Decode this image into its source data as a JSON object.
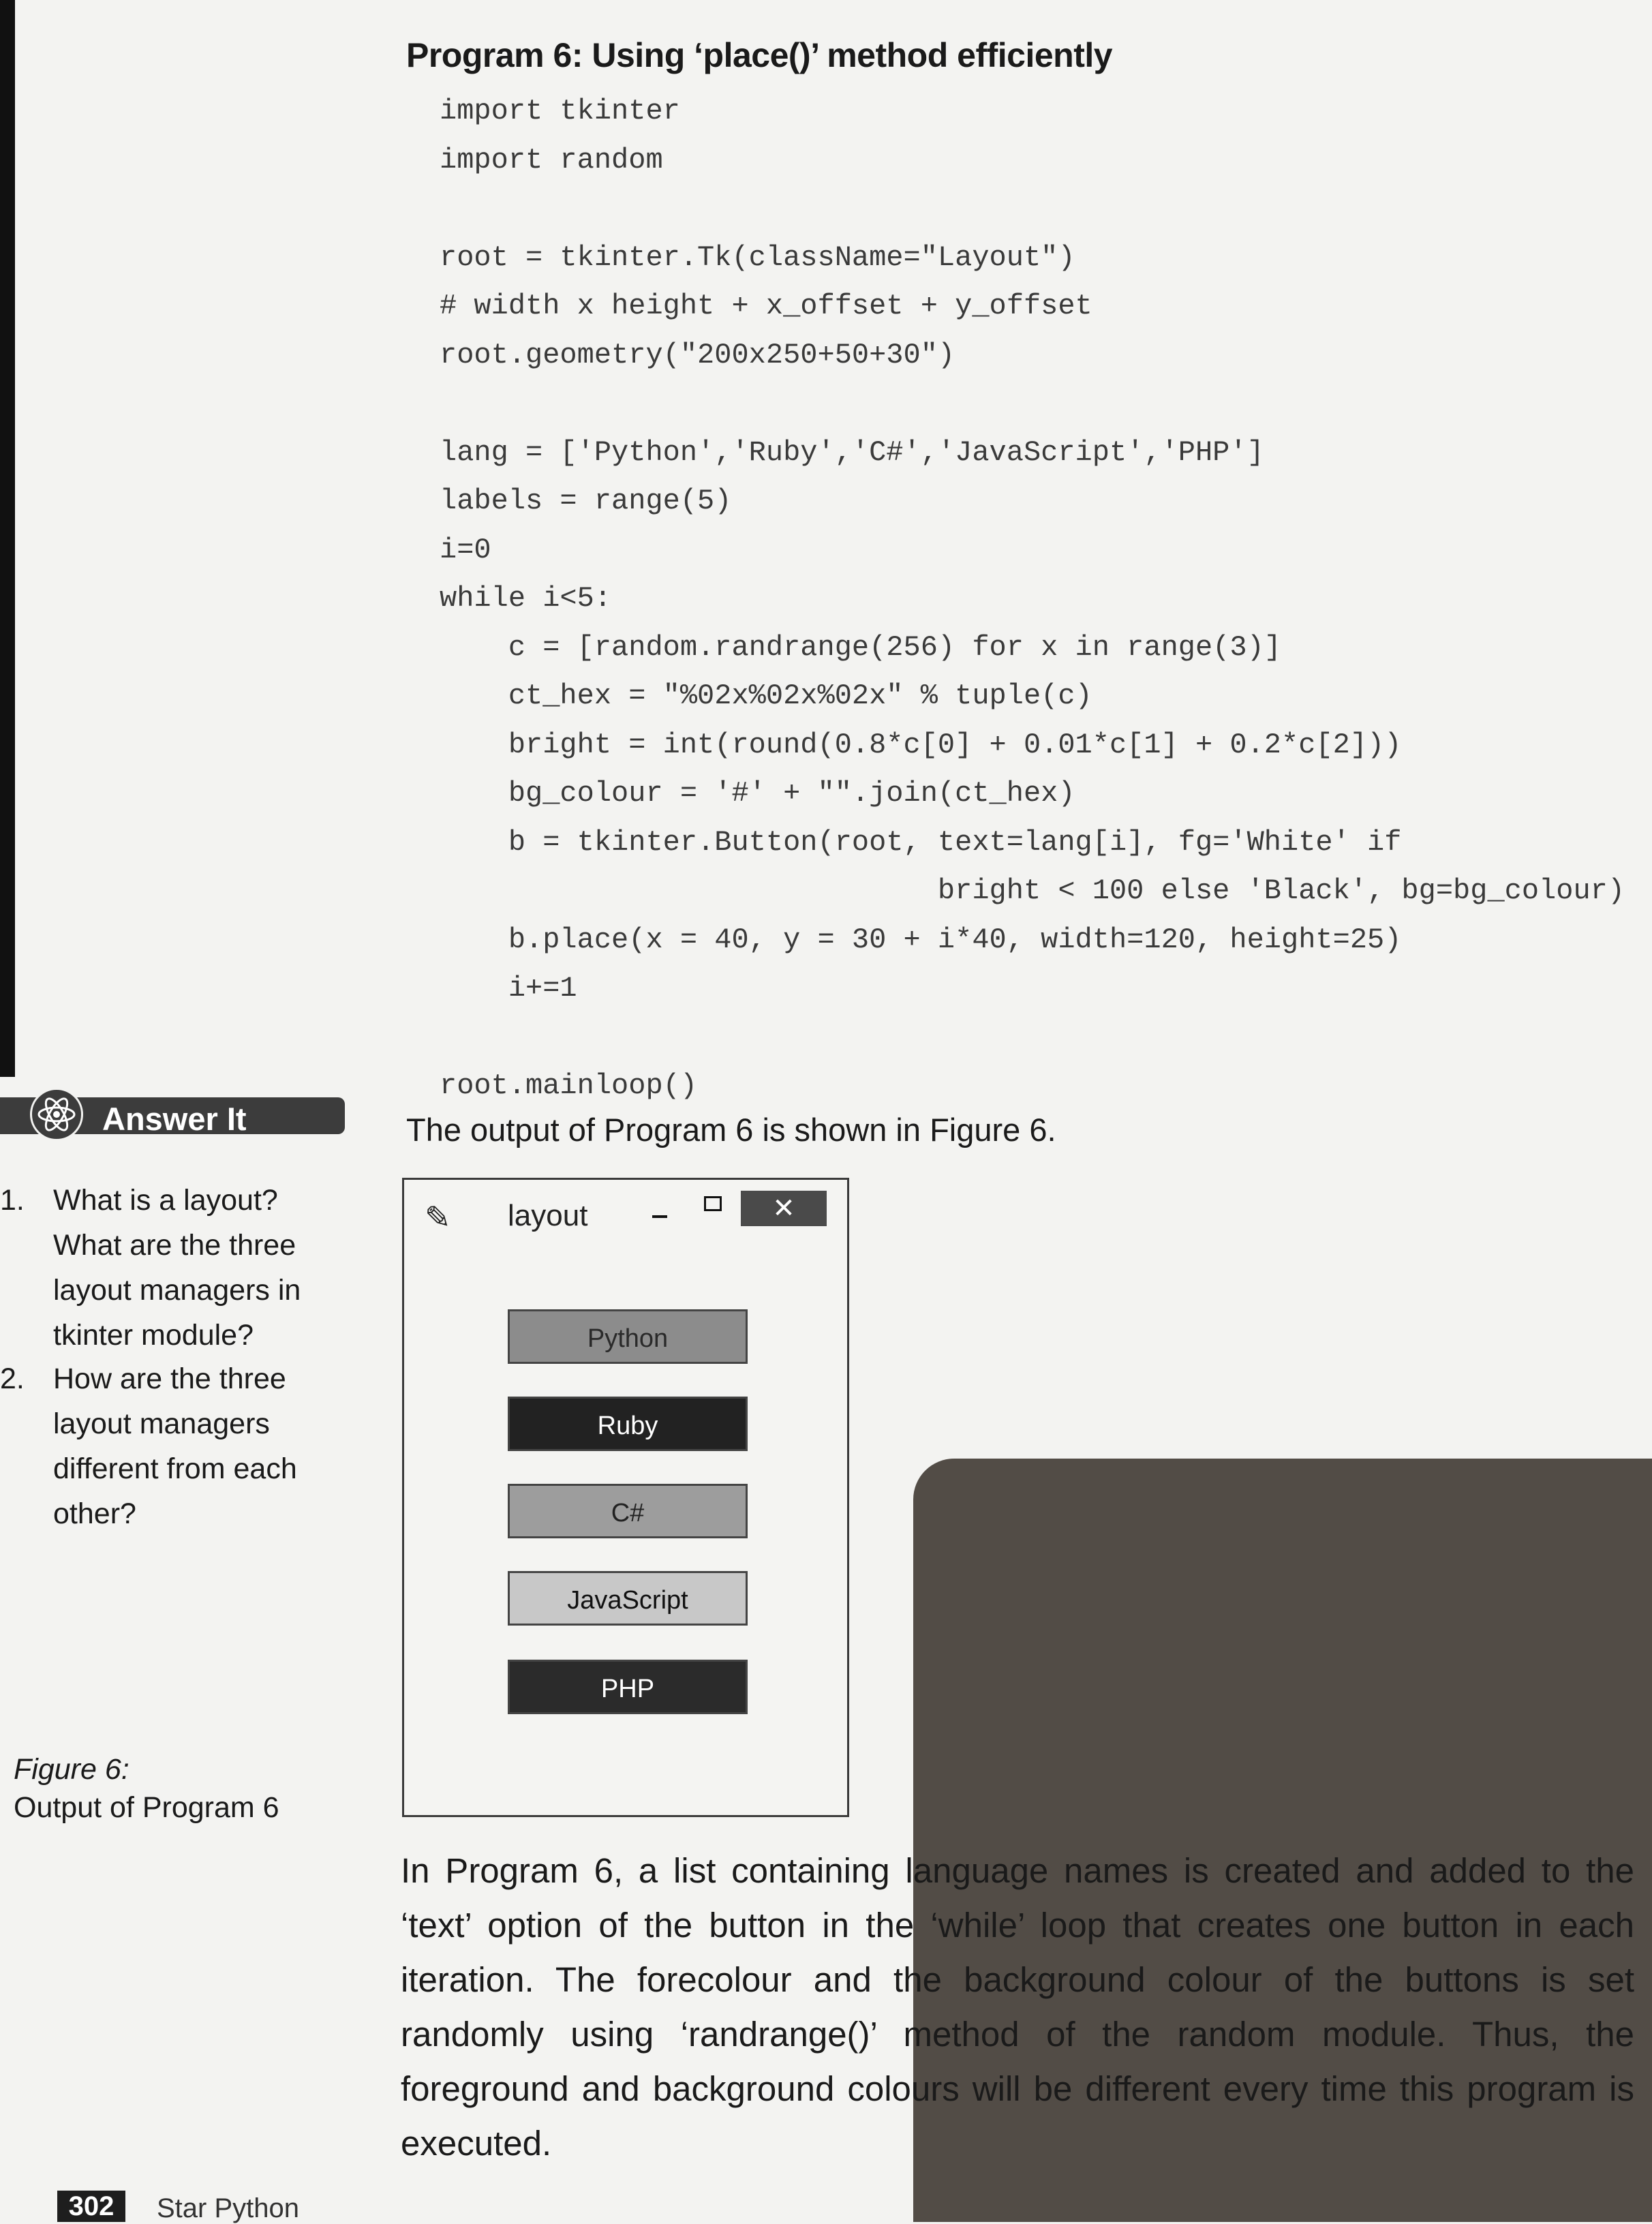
{
  "program": {
    "title": "Program 6: Using ‘place()’ method efficiently",
    "code_lines": [
      "import tkinter",
      "import random",
      "",
      "root = tkinter.Tk(className=\"Layout\")",
      "# width x height + x_offset + y_offset",
      "root.geometry(\"200x250+50+30\")",
      "",
      "lang = ['Python','Ruby','C#','JavaScript','PHP']",
      "labels = range(5)",
      "i=0",
      "while i<5:",
      "    c = [random.randrange(256) for x in range(3)]",
      "    ct_hex = \"%02x%02x%02x\" % tuple(c)",
      "    bright = int(round(0.8*c[0] + 0.01*c[1] + 0.2*c[2]))",
      "    bg_colour = '#' + \"\".join(ct_hex)",
      "    b = tkinter.Button(root, text=lang[i], fg='White' if",
      "                             bright < 100 else 'Black', bg=bg_colour)",
      "    b.place(x = 40, y = 30 + i*40, width=120, height=25)",
      "    i+=1",
      "",
      "root.mainloop()"
    ]
  },
  "output_note": "The output of Program 6 is shown in Figure 6.",
  "answer_it": {
    "title": "Answer It",
    "questions": [
      {
        "num": "1.",
        "text": "What is a layout? What are the three layout managers in tkinter module?"
      },
      {
        "num": "2.",
        "text": "How are the three layout managers different from each other?"
      }
    ]
  },
  "figure": {
    "label": "Figure 6:",
    "caption": "Output of Program 6",
    "window": {
      "title": "layout",
      "icons": {
        "app": "feather-icon",
        "minimize": "minimize-icon",
        "maximize": "maximize-icon",
        "close": "close-icon"
      },
      "close_glyph": "✕",
      "buttons": [
        {
          "text": "Python",
          "bg": "#8c8c8c",
          "fg": "#2a2a2a"
        },
        {
          "text": "Ruby",
          "bg": "#222222",
          "fg": "#ffffff"
        },
        {
          "text": "C#",
          "bg": "#9d9d9d",
          "fg": "#222222"
        },
        {
          "text": "JavaScript",
          "bg": "#c8c8c8",
          "fg": "#111111"
        },
        {
          "text": "PHP",
          "bg": "#2b2b2b",
          "fg": "#ffffff"
        }
      ]
    }
  },
  "body_text": "In Program 6, a list containing language names is created and added to the ‘text’ option of the button in the ‘while’ loop that creates one button in each iteration. The forecolour and the background colour of the buttons is set randomly using ‘randrange()’ method of the random module. Thus, the foreground and background colours will be different every time this program is executed.",
  "footer": {
    "page_number": "302",
    "book_title": "Star Python"
  }
}
